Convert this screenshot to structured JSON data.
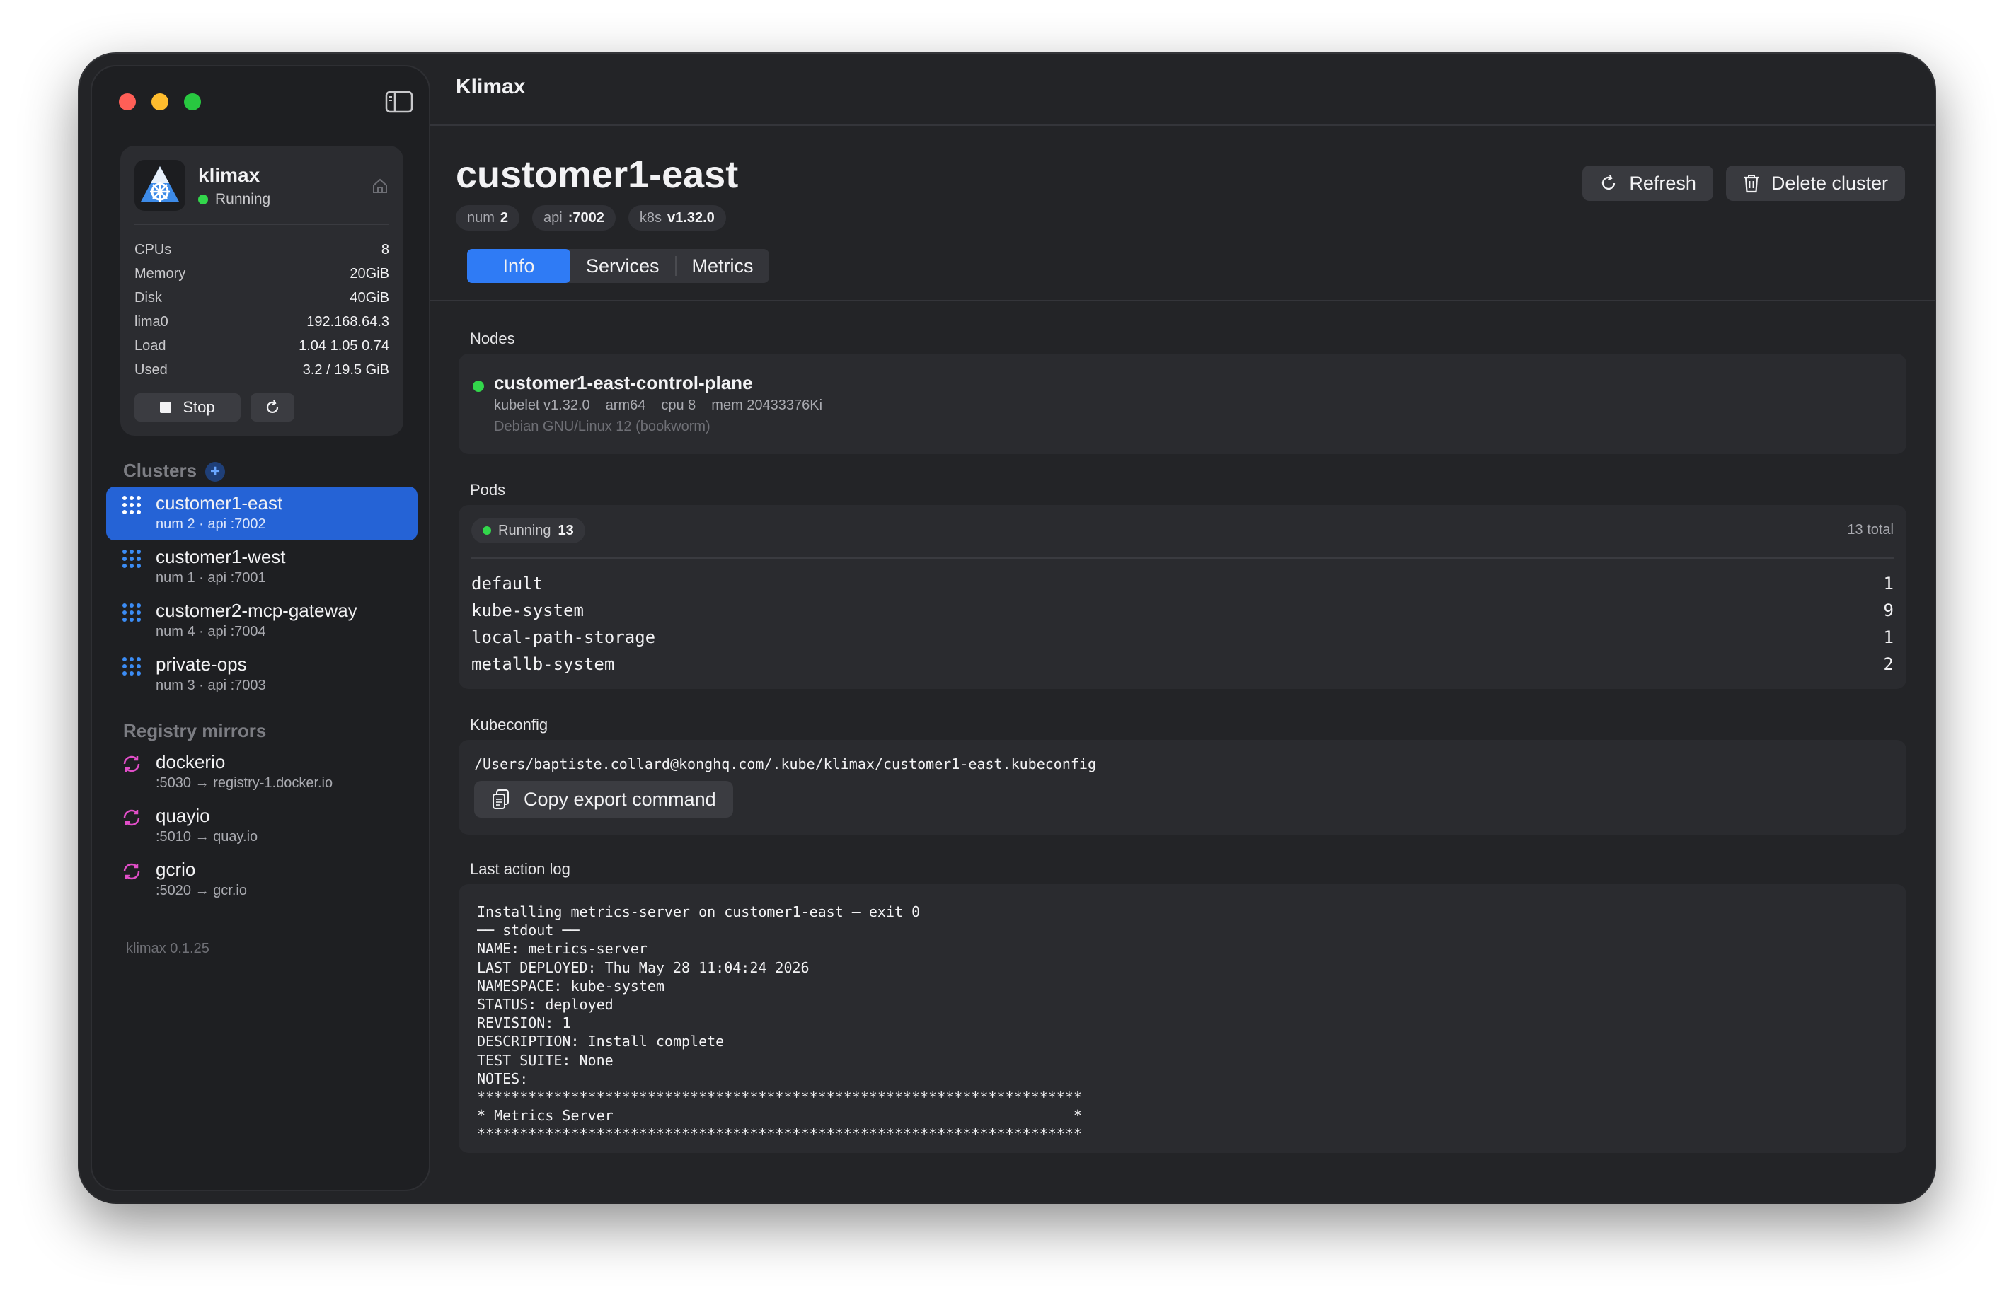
{
  "app": {
    "title": "Klimax",
    "version": "klimax 0.1.25"
  },
  "vm": {
    "name": "klimax",
    "status": "Running",
    "stats": [
      {
        "key": "CPUs",
        "value": "8"
      },
      {
        "key": "Memory",
        "value": "20GiB"
      },
      {
        "key": "Disk",
        "value": "40GiB"
      },
      {
        "key": "lima0",
        "value": "192.168.64.3"
      },
      {
        "key": "Load",
        "value": "1.04 1.05 0.74"
      },
      {
        "key": "Used",
        "value": "3.2 / 19.5 GiB"
      }
    ],
    "stop_label": "Stop"
  },
  "sidebar": {
    "clusters_heading": "Clusters",
    "clusters": [
      {
        "name": "customer1-east",
        "sub": "num 2 · api :7002",
        "selected": true
      },
      {
        "name": "customer1-west",
        "sub": "num 1 · api :7001",
        "selected": false
      },
      {
        "name": "customer2-mcp-gateway",
        "sub": "num 4 · api :7004",
        "selected": false
      },
      {
        "name": "private-ops",
        "sub": "num 3 · api :7003",
        "selected": false
      }
    ],
    "mirrors_heading": "Registry mirrors",
    "mirrors": [
      {
        "name": "dockerio",
        "sub": ":5030 → registry-1.docker.io"
      },
      {
        "name": "quayio",
        "sub": ":5010 → quay.io"
      },
      {
        "name": "gcrio",
        "sub": ":5020 → gcr.io"
      }
    ]
  },
  "cluster": {
    "title": "customer1-east",
    "chips": [
      {
        "label": "num",
        "value": "2"
      },
      {
        "label": "api",
        "value": ":7002"
      },
      {
        "label": "k8s",
        "value": "v1.32.0"
      }
    ],
    "refresh_label": "Refresh",
    "delete_label": "Delete cluster",
    "tabs": [
      {
        "label": "Info",
        "active": true
      },
      {
        "label": "Services",
        "active": false
      },
      {
        "label": "Metrics",
        "active": false
      }
    ]
  },
  "nodes": {
    "heading": "Nodes",
    "items": [
      {
        "name": "customer1-east-control-plane",
        "kubelet": "kubelet v1.32.0",
        "arch": "arm64",
        "cpu": "cpu 8",
        "mem": "mem 20433376Ki",
        "os": "Debian GNU/Linux 12 (bookworm)"
      }
    ]
  },
  "pods": {
    "heading": "Pods",
    "running_label": "Running",
    "running_count": "13",
    "total": "13 total",
    "namespaces": [
      {
        "name": "default",
        "count": "1"
      },
      {
        "name": "kube-system",
        "count": "9"
      },
      {
        "name": "local-path-storage",
        "count": "1"
      },
      {
        "name": "metallb-system",
        "count": "2"
      }
    ]
  },
  "kubeconfig": {
    "heading": "Kubeconfig",
    "path": "/Users/baptiste.collard@konghq.com/.kube/klimax/customer1-east.kubeconfig",
    "copy_label": "Copy export command"
  },
  "log": {
    "heading": "Last action log",
    "text": "Installing metrics-server on customer1-east — exit 0\n── stdout ──\nNAME: metrics-server\nLAST DEPLOYED: Thu May 28 11:04:24 2026\nNAMESPACE: kube-system\nSTATUS: deployed\nREVISION: 1\nDESCRIPTION: Install complete\nTEST SUITE: None\nNOTES:\n***********************************************************************\n* Metrics Server                                                      *\n***********************************************************************"
  }
}
